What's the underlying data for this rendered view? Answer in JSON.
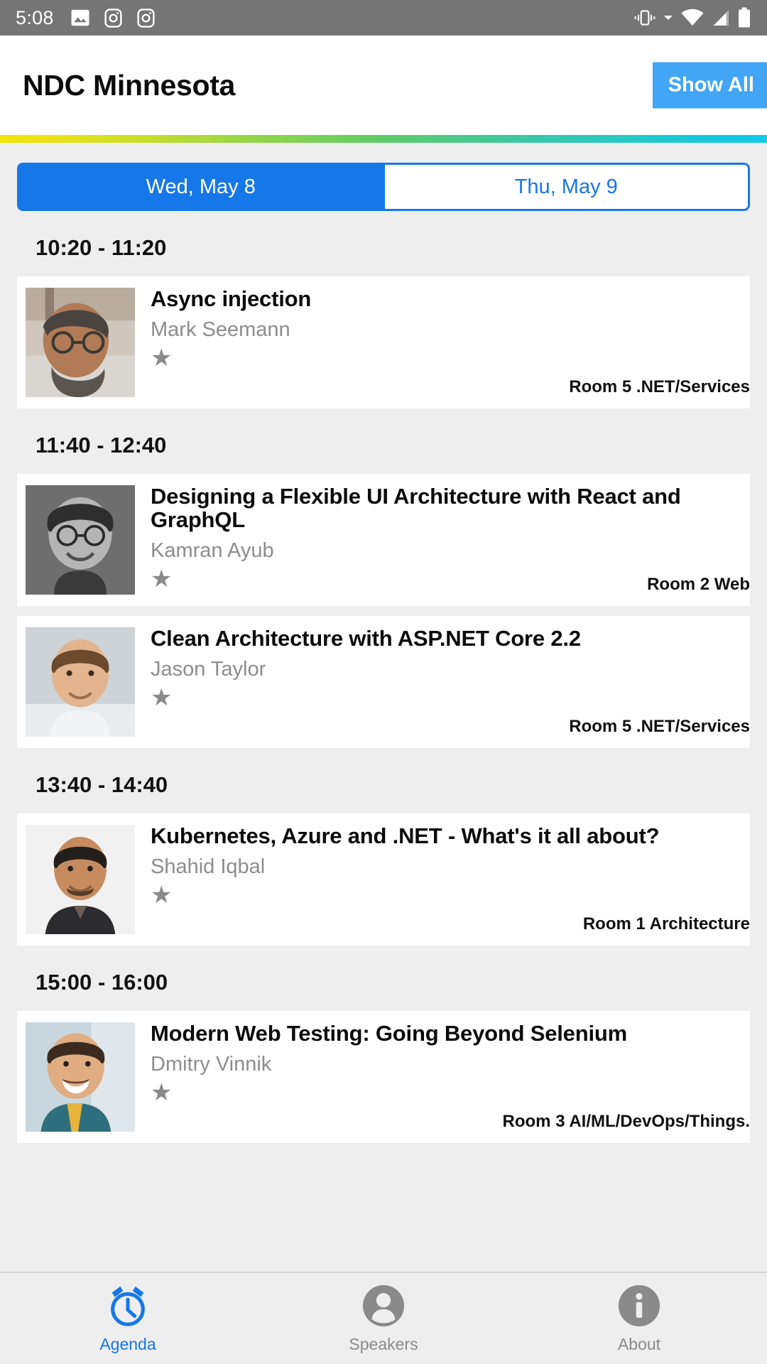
{
  "statusbar": {
    "time": "5:08",
    "left_icons": [
      "photo-icon",
      "camera-icon",
      "camera-icon"
    ],
    "right_icons": [
      "vibrate-icon",
      "chevron-down-icon",
      "wifi-icon",
      "cellular-signal-icon",
      "battery-icon"
    ]
  },
  "header": {
    "title": "NDC Minnesota",
    "show_all_label": "Show All",
    "show_all_color": "#42A5F5"
  },
  "gradient": {
    "from": "#f5e400",
    "mid": "#5ecb69",
    "to": "#12c9ea"
  },
  "tabs": [
    {
      "label": "Wed, May 8",
      "active": true
    },
    {
      "label": "Thu, May 9",
      "active": false
    }
  ],
  "accent_color": "#1677E8",
  "groups": [
    {
      "time": "10:20 - 11:20",
      "sessions": [
        {
          "title": "Async injection",
          "speaker": "Mark Seemann",
          "room": "Room 5 .NET/Services",
          "star": "★"
        }
      ]
    },
    {
      "time": "11:40 - 12:40",
      "sessions": [
        {
          "title": "Designing a Flexible UI Architecture with React and GraphQL",
          "speaker": "Kamran Ayub",
          "room": "Room 2 Web",
          "star": "★"
        },
        {
          "title": "Clean Architecture with ASP.NET Core 2.2",
          "speaker": "Jason Taylor",
          "room": "Room 5 .NET/Services",
          "star": "★"
        }
      ]
    },
    {
      "time": "13:40 - 14:40",
      "sessions": [
        {
          "title": "Kubernetes, Azure and .NET - What's it all about?",
          "speaker": "Shahid Iqbal",
          "room": "Room 1 Architecture",
          "star": "★"
        }
      ]
    },
    {
      "time": "15:00 - 16:00",
      "sessions": [
        {
          "title": "Modern Web Testing: Going Beyond Selenium",
          "speaker": "Dmitry Vinnik",
          "room": "Room 3 AI/ML/DevOps/Things.",
          "star": "★"
        }
      ]
    }
  ],
  "bottomnav": [
    {
      "label": "Agenda",
      "icon": "alarm-clock-icon",
      "active": true
    },
    {
      "label": "Speakers",
      "icon": "person-icon",
      "active": false
    },
    {
      "label": "About",
      "icon": "info-icon",
      "active": false
    }
  ]
}
